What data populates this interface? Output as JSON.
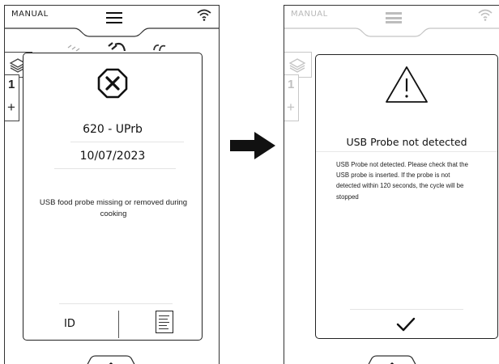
{
  "left_screen": {
    "mode": "MANUAL",
    "side_tab": {
      "number": "1",
      "add": "+"
    },
    "error_dialog": {
      "code": "620 - UPrb",
      "date": "10/07/2023",
      "message": "USB food probe missing or removed during cooking",
      "id_label": "ID"
    }
  },
  "right_screen": {
    "mode": "MANUAL",
    "side_tab": {
      "number": "1",
      "add": "+"
    },
    "warning_dialog": {
      "title": "USB Probe not detected",
      "body": "USB Probe not detected. Please check that the USB probe is inserted. If the probe is not detected within 120 seconds, the cycle will be stopped"
    }
  },
  "icons": [
    "menu-icon",
    "wifi-icon",
    "heat-icons",
    "layers-icon",
    "error-x-icon",
    "document-icon",
    "warning-triangle-icon",
    "checkmark-icon",
    "chevron-up-icon",
    "right-arrow-icon"
  ],
  "colors": {
    "foreground": "#1a1a1a",
    "dimmed": "#bdbdbd",
    "background": "#ffffff"
  }
}
